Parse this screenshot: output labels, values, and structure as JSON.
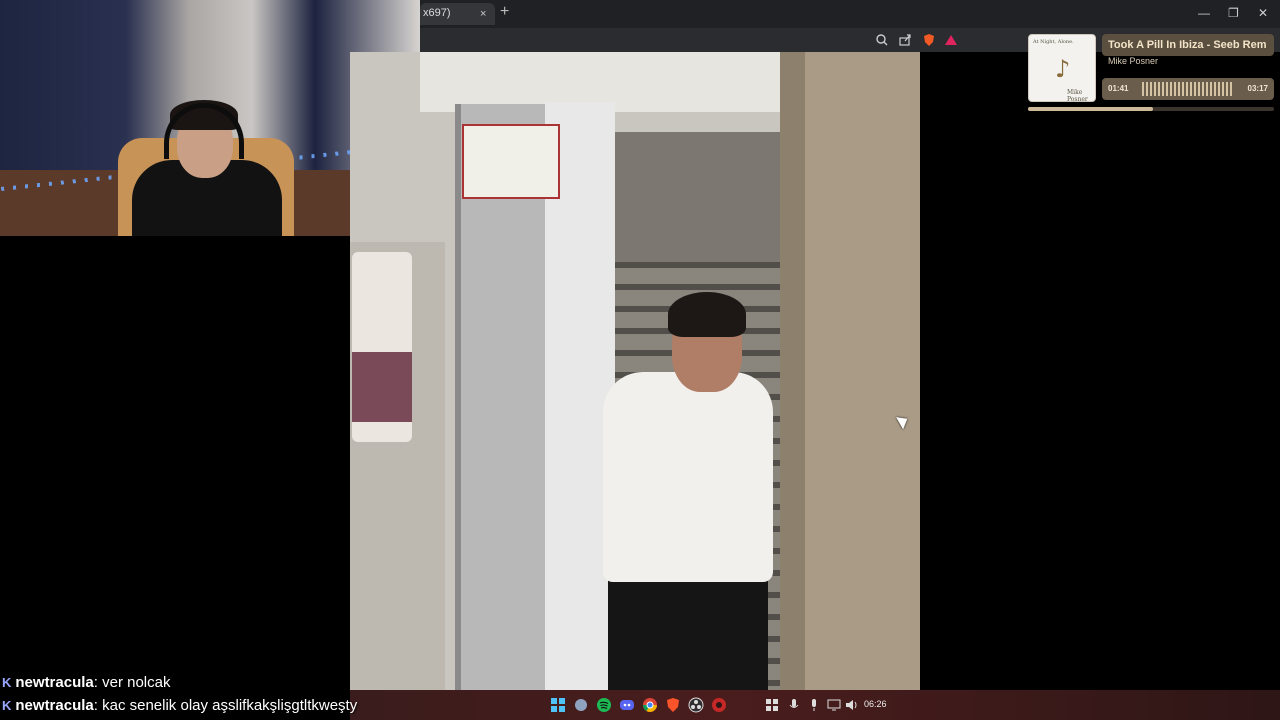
{
  "browser": {
    "tab_title": "x697)",
    "tab_close": "×",
    "new_tab": "+",
    "window_minimize": "—",
    "window_restore": "❐",
    "window_close": "✕",
    "toolbar_icons": [
      "zoom-icon",
      "share-icon",
      "brave-shield-icon",
      "brave-rewards-icon"
    ]
  },
  "music": {
    "title": "Took A Pill In Ibiza - Seeb Rem",
    "artist": "Mike Posner",
    "elapsed": "01:41",
    "duration": "03:17",
    "progress_fraction": 0.51,
    "album_text": "At Night, Alone.",
    "album_sign": "Mike Posner",
    "accent": "#cdb99a"
  },
  "chat": {
    "lines": [
      {
        "user": "newtracula",
        "message": "ver nolcak"
      },
      {
        "user": "newtracula",
        "message": "kac senelik olay aşslifkakşlişgtltkweşty"
      }
    ],
    "badge": "K"
  },
  "taskbar": {
    "time": "06:26",
    "apps": [
      "windows-start-icon",
      "network-app-icon",
      "spotify-icon",
      "discord-icon",
      "chrome-icon",
      "brave-icon",
      "obs-icon",
      "app-icon"
    ],
    "tray": [
      "app-grid-icon",
      "mic-icon",
      "microphone-icon",
      "display-icon",
      "volume-icon"
    ]
  }
}
